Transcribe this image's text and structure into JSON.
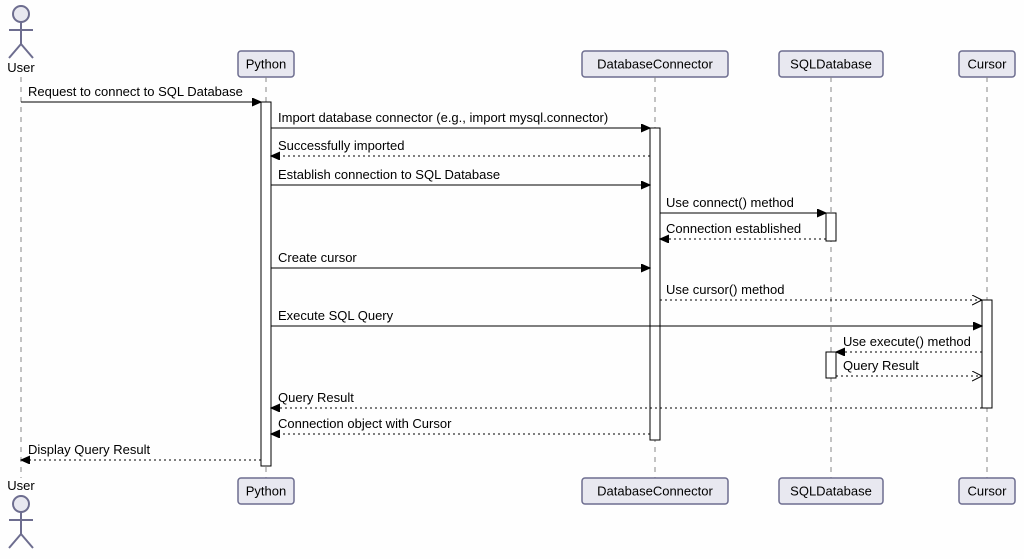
{
  "actor": {
    "name": "User"
  },
  "participants": {
    "python": "Python",
    "db_connector": "DatabaseConnector",
    "sql_db": "SQLDatabase",
    "cursor": "Cursor"
  },
  "messages": {
    "m1": "Request to connect to SQL Database",
    "m2": "Import database connector (e.g., import mysql.connector)",
    "m3": "Successfully imported",
    "m4": "Establish connection to SQL Database",
    "m5": "Use connect() method",
    "m6": "Connection established",
    "m7": "Create cursor",
    "m8": "Use cursor() method",
    "m9": "Execute SQL Query",
    "m10": "Use execute() method",
    "m11": "Query Result",
    "m12": "Query Result",
    "m13": "Connection object with Cursor",
    "m14": "Display Query Result"
  },
  "chart_data": {
    "type": "sequence-diagram",
    "actors": [
      "User"
    ],
    "participants": [
      "Python",
      "DatabaseConnector",
      "SQLDatabase",
      "Cursor"
    ],
    "messages": [
      {
        "from": "User",
        "to": "Python",
        "text": "Request to connect to SQL Database",
        "kind": "sync"
      },
      {
        "from": "Python",
        "to": "DatabaseConnector",
        "text": "Import database connector (e.g., import mysql.connector)",
        "kind": "sync"
      },
      {
        "from": "DatabaseConnector",
        "to": "Python",
        "text": "Successfully imported",
        "kind": "return"
      },
      {
        "from": "Python",
        "to": "DatabaseConnector",
        "text": "Establish connection to SQL Database",
        "kind": "sync"
      },
      {
        "from": "DatabaseConnector",
        "to": "SQLDatabase",
        "text": "Use connect() method",
        "kind": "sync"
      },
      {
        "from": "SQLDatabase",
        "to": "DatabaseConnector",
        "text": "Connection established",
        "kind": "return"
      },
      {
        "from": "Python",
        "to": "DatabaseConnector",
        "text": "Create cursor",
        "kind": "sync"
      },
      {
        "from": "DatabaseConnector",
        "to": "Cursor",
        "text": "Use cursor() method",
        "kind": "async"
      },
      {
        "from": "Python",
        "to": "Cursor",
        "text": "Execute SQL Query",
        "kind": "sync"
      },
      {
        "from": "Cursor",
        "to": "SQLDatabase",
        "text": "Use execute() method",
        "kind": "return"
      },
      {
        "from": "SQLDatabase",
        "to": "Cursor",
        "text": "Query Result",
        "kind": "async"
      },
      {
        "from": "Cursor",
        "to": "Python",
        "text": "Query Result",
        "kind": "return"
      },
      {
        "from": "DatabaseConnector",
        "to": "Python",
        "text": "Connection object with Cursor",
        "kind": "return"
      },
      {
        "from": "Python",
        "to": "User",
        "text": "Display Query Result",
        "kind": "return"
      }
    ]
  }
}
